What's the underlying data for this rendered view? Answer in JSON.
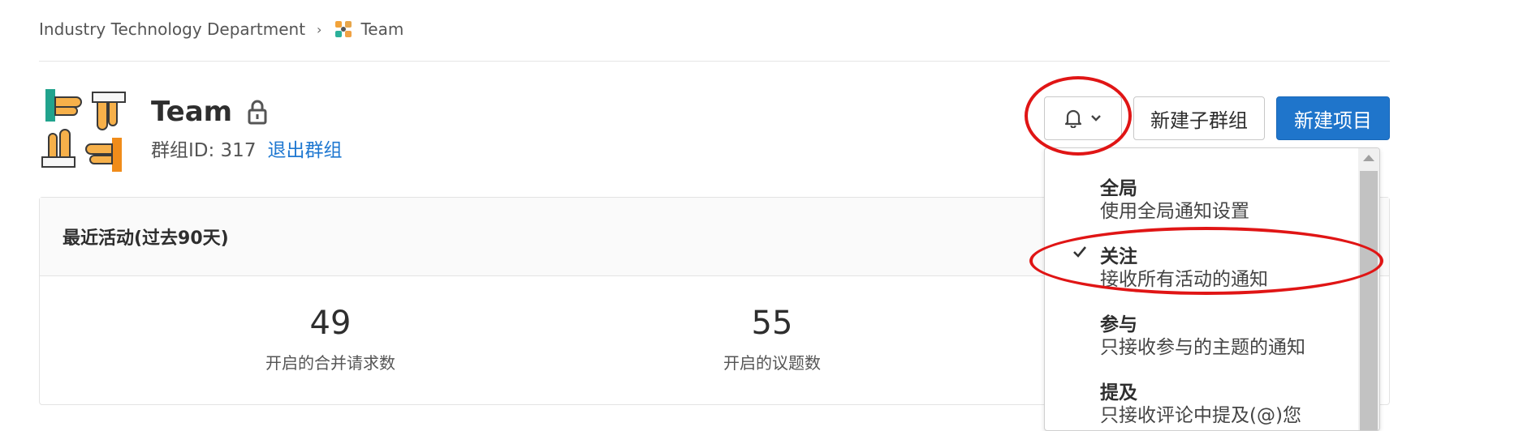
{
  "breadcrumb": {
    "parent": "Industry Technology Department",
    "current": "Team"
  },
  "group": {
    "name": "Team",
    "id_text": "群组ID: 317",
    "leave_label": "退出群组"
  },
  "actions": {
    "notifications_icon": "bell-icon",
    "new_subgroup_label": "新建子群组",
    "new_project_label": "新建项目"
  },
  "activity": {
    "title": "最近活动(过去90天)",
    "stats": [
      {
        "value": "49",
        "label": "开启的合并请求数"
      },
      {
        "value": "55",
        "label": "开启的议题数"
      }
    ]
  },
  "notification_menu": {
    "selected": "关注",
    "items": [
      {
        "title": "全局",
        "desc": "使用全局通知设置"
      },
      {
        "title": "关注",
        "desc": "接收所有活动的通知"
      },
      {
        "title": "参与",
        "desc": "只接收参与的主题的通知"
      },
      {
        "title": "提及",
        "desc": "只接收评论中提及(@)您"
      }
    ]
  },
  "colors": {
    "accent": "#1f75cb",
    "annotation": "#e01515"
  }
}
